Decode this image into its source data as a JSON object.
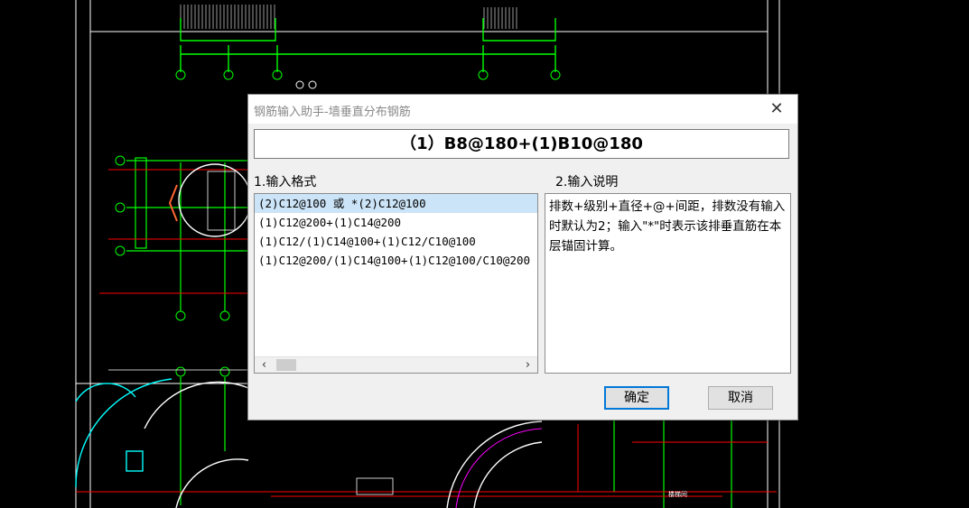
{
  "dialog": {
    "title": "钢筋输入助手-墙垂直分布钢筋",
    "close_glyph": "✕",
    "formula": "（1）B8@180+(1)B10@180",
    "format_label": "1.输入格式",
    "desc_label": "2.输入说明",
    "formats": [
      "(2)C12@100 或 *(2)C12@100",
      "(1)C12@200+(1)C14@200",
      "(1)C12/(1)C14@100+(1)C12/C10@100",
      "(1)C12@200/(1)C14@100+(1)C12@100/C10@200"
    ],
    "selected_index": 0,
    "description": "排数+级别+直径+@+间距，排数没有输入时默认为2；输入\"*\"时表示该排垂直筋在本层锚固计算。",
    "ok_label": "确定",
    "cancel_label": "取消",
    "scroll_left": "‹",
    "scroll_right": "›"
  },
  "colors": {
    "background": "#000000",
    "cad_white": "#ffffff",
    "cad_green": "#00ff00",
    "cad_red": "#ff0000",
    "cad_cyan": "#00ffff",
    "cad_magenta": "#ff00ff",
    "accent": "#0078d7",
    "selection": "#cce4f7"
  }
}
